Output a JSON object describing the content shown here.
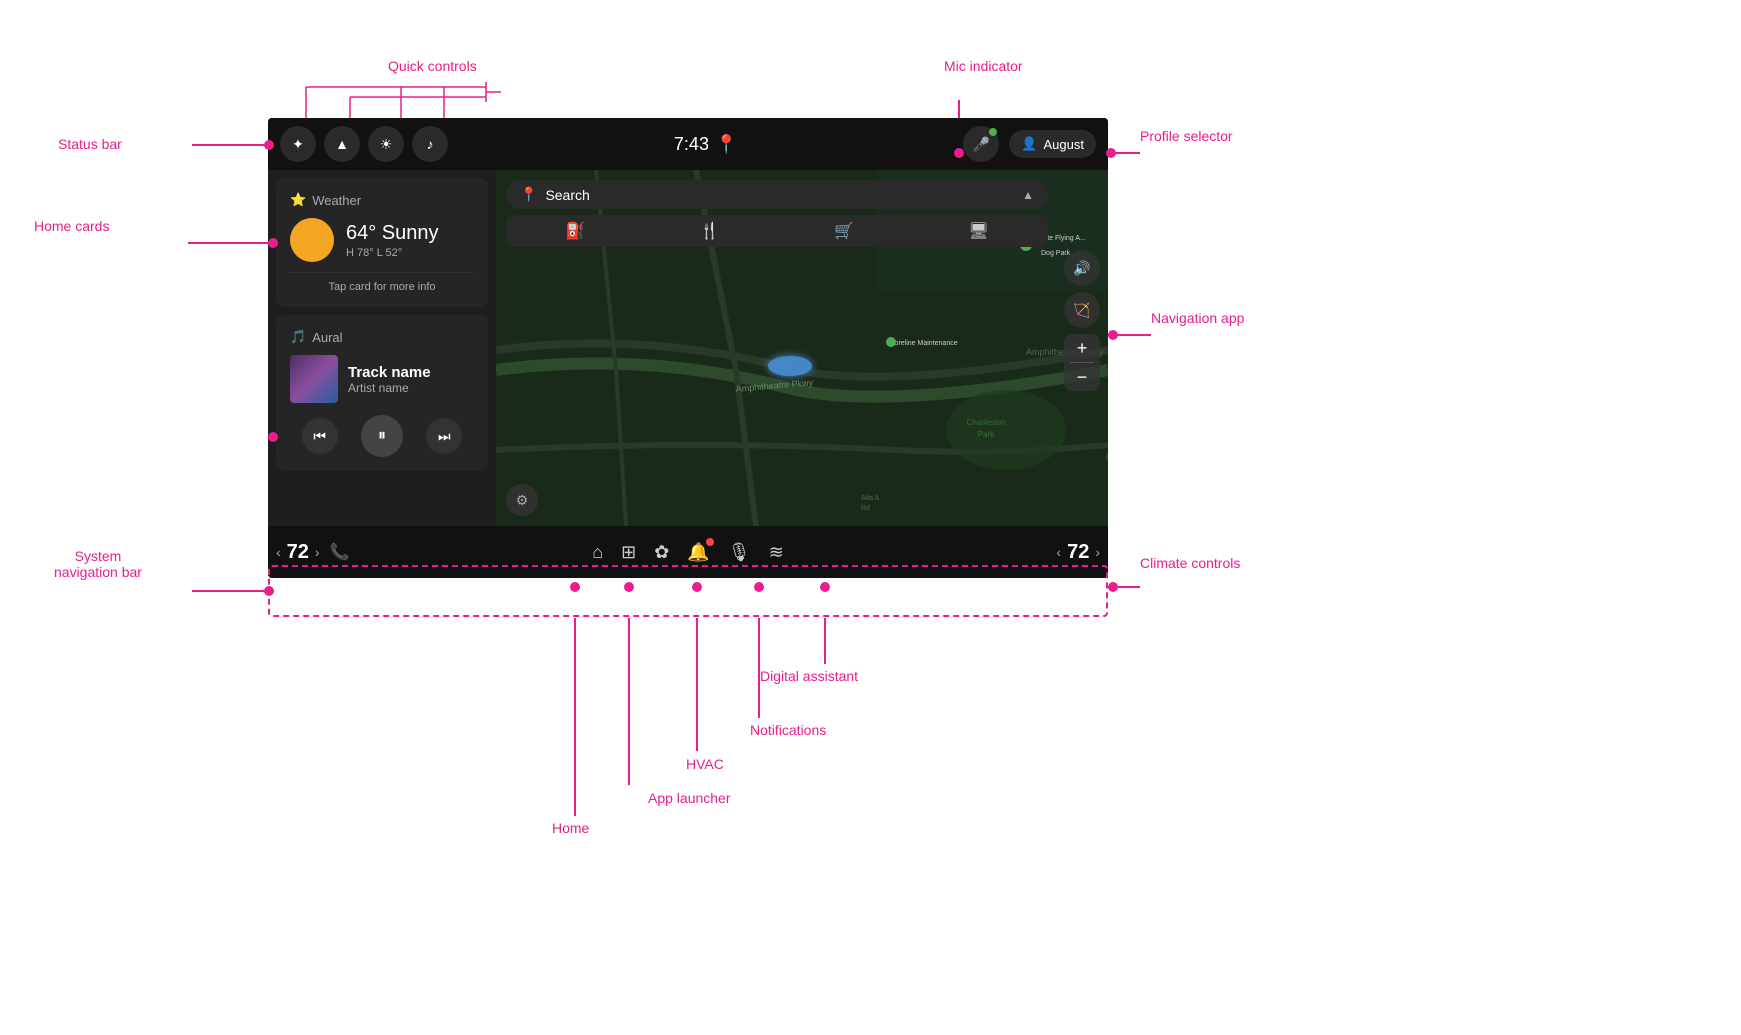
{
  "labels": {
    "quick_controls": "Quick controls",
    "mic_indicator": "Mic indicator",
    "status_bar": "Status bar",
    "home_cards": "Home cards",
    "profile_selector": "Profile selector",
    "navigation_app": "Navigation app",
    "system_nav_bar": "System\nnavigation bar",
    "climate_controls": "Climate controls",
    "digital_assistant": "Digital assistant",
    "notifications": "Notifications",
    "hvac": "HVAC",
    "app_launcher": "App launcher",
    "home": "Home",
    "aural": "Aural",
    "track_name": "Track name",
    "artist_name": "Artist name",
    "search": "Search",
    "navigation_app_label": "Navigation app"
  },
  "status_bar": {
    "time": "7:43",
    "profile_name": "August"
  },
  "weather": {
    "title": "Weather",
    "temperature": "64° Sunny",
    "high_low": "H 78° L 52°",
    "tap_info": "Tap card for more info"
  },
  "music": {
    "app_name": "Aural",
    "track_name": "Track name",
    "artist_name": "Artist name"
  },
  "search": {
    "placeholder": "Search"
  },
  "climate": {
    "left_temp": "72",
    "right_temp": "72"
  },
  "icons": {
    "bluetooth": "✦",
    "signal": "▲",
    "brightness": "☀",
    "volume": "♪",
    "mic": "🎤",
    "profile": "👤",
    "home": "⌂",
    "apps": "⊞",
    "fan": "✿",
    "bell": "🔔",
    "assistant": "🎙",
    "phone_fan": "≋",
    "settings": "⚙",
    "prev": "⏮",
    "pause": "⏸",
    "next": "⏭",
    "sound": "🔊",
    "nav_arrow": "🏹",
    "zoom_plus": "+",
    "zoom_minus": "−",
    "nav_left": "‹",
    "nav_right": "›"
  }
}
